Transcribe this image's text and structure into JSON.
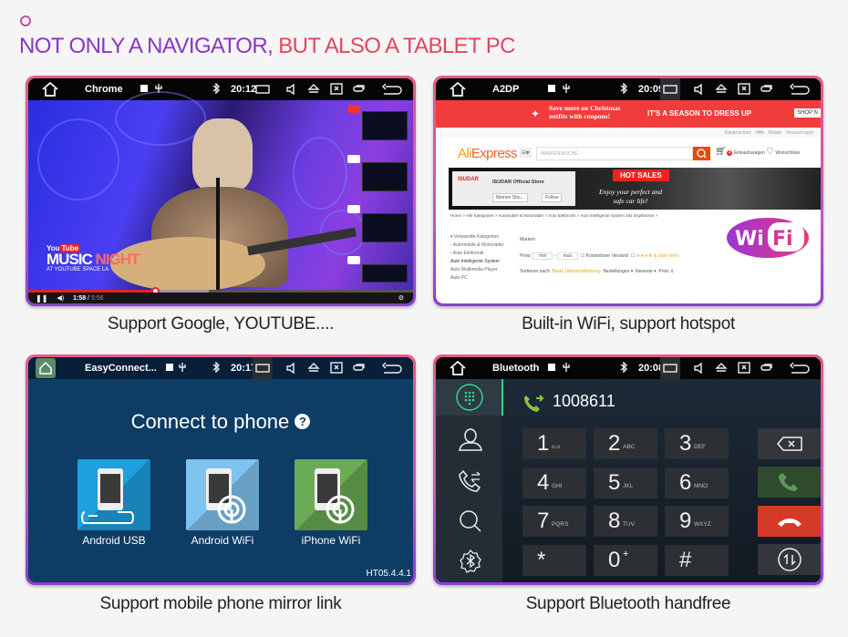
{
  "headline": {
    "part1": "NOT ONLY A NAVIGATOR,",
    "part2": " BUT ALSO A TABLET PC",
    "color1": "#8a35c9",
    "color2": "#e3455f"
  },
  "panels": [
    {
      "id": "chrome",
      "status_bar": {
        "app_title": "Chrome",
        "time": "20:12"
      },
      "caption": "Support Google, YOUTUBE....",
      "video": {
        "overlay_brand": "You",
        "overlay_brand_box": "Tube",
        "title_white": "MUSIC",
        "title_red": "NIGHT",
        "subtitle": "AT YOUTUBE SPACE LA",
        "time_current": "1:58",
        "time_total": "5:56",
        "progress_fraction": 0.33,
        "buffer_fraction": 0.47
      }
    },
    {
      "id": "aliexpress",
      "status_bar": {
        "app_title": "A2DP",
        "time": "20:09"
      },
      "caption": "Built-in WiFi, support hotspot",
      "promo": {
        "line1": "Save more on Christmas",
        "line2": "outfits with coupons!",
        "tagline": "IT'S A SEASON TO DRESS UP",
        "shop_button": "SHOP N"
      },
      "top_links": [
        "Käuferschutz",
        "Hilfe",
        "Mobile",
        "Versand nach"
      ],
      "logo": {
        "ali": "Ali",
        "express": "Express"
      },
      "search_placeholder": "MARKENWOCHE",
      "cart": {
        "count": "4",
        "label": "Einkaufswagen"
      },
      "wishlist": "Wunschliste",
      "store": {
        "brand": "ISUDAR",
        "name": "ISUDAR Official Store",
        "my_shop": "Meinen Sho...",
        "follow": "Follow"
      },
      "banner": {
        "hot": "HOT SALES",
        "line1": "Enjoy your perfect and",
        "line2": "safe car life!"
      },
      "breadcrumb": "Home > Alle Kategorien > Automobile & Motorräder > Auto Elektronik > Auto Intelligente System  181 Ergebnisse >",
      "sidebar": [
        "▾ Verwandte Kategorien",
        "‹ Automobile & Motorräder",
        "‹ Auto Elektronik",
        "Auto Intelligente System",
        "Auto Multimedia Player",
        "Auto PC"
      ],
      "filters": {
        "brands_label": "Marken:",
        "price_label": "Preis:",
        "price_min": "min",
        "price_max": "max",
        "free_shipping": "Kostenloser Versand",
        "rating": "★★★★ & oder mehr",
        "sort_label": "Sortieren nach:",
        "sort_options": [
          "Beste Übereinstimmung",
          "Bestellungen ▾",
          "Neueste ▾",
          "Preis ⇕"
        ]
      },
      "wifi_badge": {
        "wi": "Wi",
        "fi": "Fi"
      }
    },
    {
      "id": "easyconnect",
      "status_bar": {
        "app_title": "EasyConnect...",
        "time": "20:17"
      },
      "caption": "Support mobile phone mirror link",
      "title": "Connect to phone",
      "help": "?",
      "tiles": [
        {
          "label": "Android USB",
          "color": "#1e9fde"
        },
        {
          "label": "Android WiFi",
          "color": "#7fc3ef"
        },
        {
          "label": "iPhone WiFi",
          "color": "#6aab55"
        }
      ],
      "version": "HT05.4.4.1"
    },
    {
      "id": "bluetooth",
      "status_bar": {
        "app_title": "Bluetooth",
        "time": "20:08"
      },
      "caption": "Support Bluetooth handfree",
      "number": "1008611",
      "keys": [
        {
          "d": "1",
          "l": "o.o"
        },
        {
          "d": "2",
          "l": "ABC"
        },
        {
          "d": "3",
          "l": "DEF"
        },
        {
          "d": "4",
          "l": "GHI"
        },
        {
          "d": "5",
          "l": "JKL"
        },
        {
          "d": "6",
          "l": "MNO"
        },
        {
          "d": "7",
          "l": "PQRS"
        },
        {
          "d": "8",
          "l": "TUV"
        },
        {
          "d": "9",
          "l": "WXYZ"
        },
        {
          "d": "*",
          "l": ""
        },
        {
          "d": "0",
          "l": "+"
        },
        {
          "d": "#",
          "l": ""
        }
      ],
      "call_color": "#2f4a2c",
      "hangup_color": "#d53a28"
    }
  ]
}
